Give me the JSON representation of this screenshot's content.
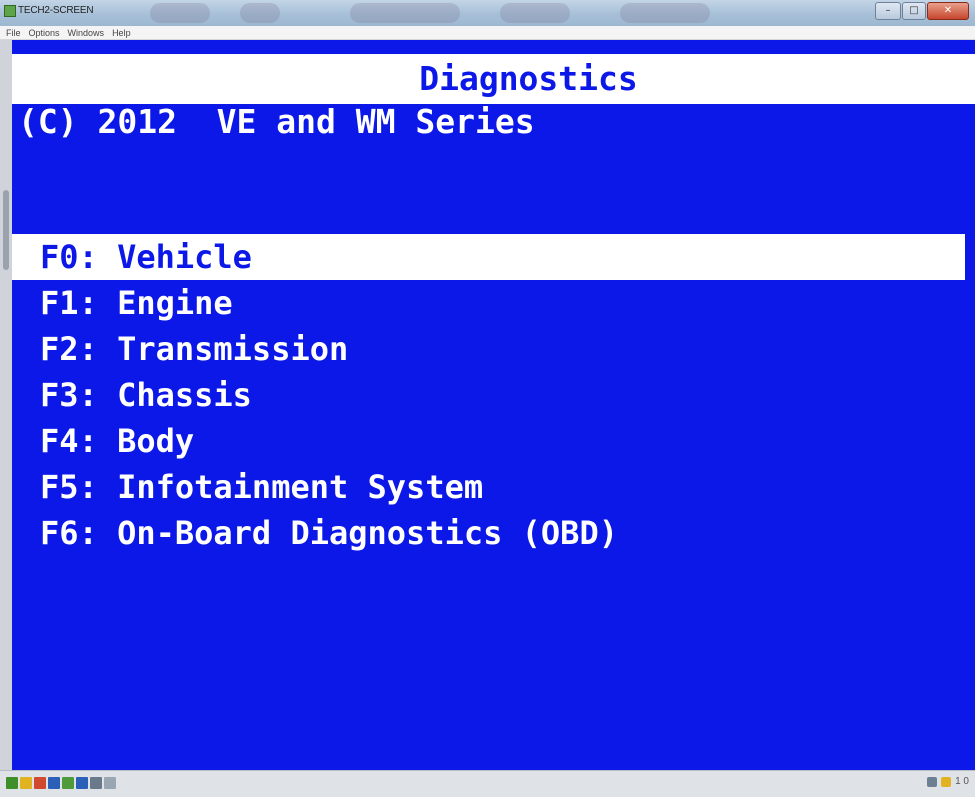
{
  "window": {
    "title": "TECH2-SCREEN"
  },
  "menubar": {
    "items": [
      "File",
      "Options",
      "Windows",
      "Help"
    ]
  },
  "screen": {
    "title": "Diagnostics",
    "subtitle": "(C) 2012  VE and WM Series",
    "menu": [
      {
        "key": "F0:",
        "label": "Vehicle",
        "selected": true
      },
      {
        "key": "F1:",
        "label": "Engine"
      },
      {
        "key": "F2:",
        "label": "Transmission"
      },
      {
        "key": "F3:",
        "label": "Chassis"
      },
      {
        "key": "F4:",
        "label": "Body"
      },
      {
        "key": "F5:",
        "label": "Infotainment System"
      },
      {
        "key": "F6:",
        "label": "On-Board Diagnostics (OBD)"
      }
    ]
  },
  "colors": {
    "screen_bg": "#0b18e8",
    "highlight_bg": "#ffffff",
    "text": "#ffffff"
  },
  "taskbar": {
    "clock_fragment": "1 0"
  }
}
